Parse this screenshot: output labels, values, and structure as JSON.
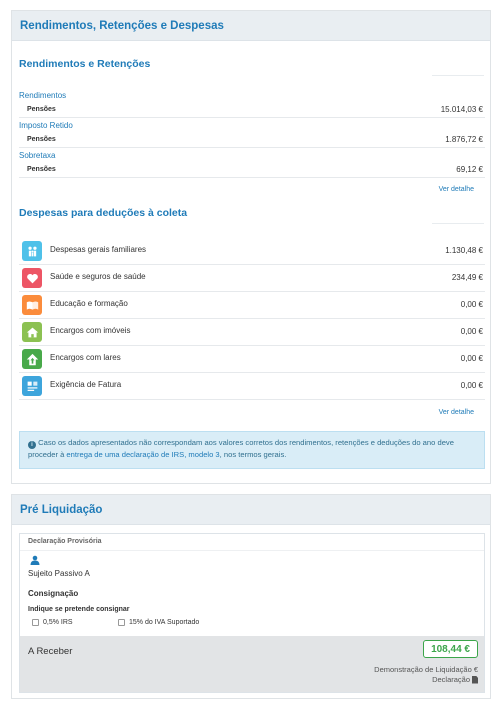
{
  "panel1": {
    "title": "Rendimentos, Retenções e Despesas",
    "rendimentos_title": "Rendimentos e Retenções",
    "groups": [
      {
        "head": "Rendimentos",
        "label": "Pensões",
        "value": "15.014,03 €"
      },
      {
        "head": "Imposto Retido",
        "label": "Pensões",
        "value": "1.876,72 €"
      },
      {
        "head": "Sobretaxa",
        "label": "Pensões",
        "value": "69,12 €"
      }
    ],
    "detail_link_1": "Ver detalhe",
    "despesas_title": "Despesas para deduções à coleta",
    "expenses": [
      {
        "label": "Despesas gerais familiares",
        "value": "1.130,48 €",
        "icon": "family-icon",
        "color": "#4fc1e9"
      },
      {
        "label": "Saúde e seguros de saúde",
        "value": "234,49 €",
        "icon": "heart-icon",
        "color": "#ed5565"
      },
      {
        "label": "Educação e formação",
        "value": "0,00 €",
        "icon": "book-icon",
        "color": "#fb8c3c"
      },
      {
        "label": "Encargos com imóveis",
        "value": "0,00 €",
        "icon": "house-icon",
        "color": "#8cc152"
      },
      {
        "label": "Encargos com lares",
        "value": "0,00 €",
        "icon": "home-arrow-icon",
        "color": "#48a94a"
      },
      {
        "label": "Exigência de Fatura",
        "value": "0,00 €",
        "icon": "invoice-icon",
        "color": "#3da5dc"
      }
    ],
    "detail_link_2": "Ver detalhe",
    "info": {
      "text1": "Caso os dados apresentados não correspondam aos valores corretos dos rendimentos, retenções e deduções do ano deve proceder à ",
      "link": "entrega de uma declaração de IRS, modelo 3",
      "text2": ", nos termos gerais."
    }
  },
  "panel2": {
    "title": "Pré Liquidação",
    "declaracao_label": "Declaração Provisória",
    "sujeito": "Sujeito Passivo A",
    "consignacao": "Consignação",
    "indique": "Indique se pretende consignar",
    "option_irs": "0,5% IRS",
    "option_iva": "15% do IVA Suportado",
    "receber_label": "A Receber",
    "amount": "108,44 €",
    "demonstracao": "Demonstração de Liquidação €",
    "declaracao": "Declaração"
  }
}
